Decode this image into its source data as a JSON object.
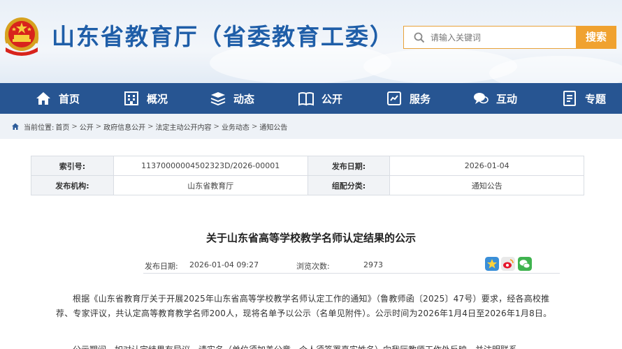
{
  "header": {
    "site_title": "山东省教育厅（省委教育工委）",
    "search_placeholder": "请输入关键词",
    "search_button": "搜索"
  },
  "nav": {
    "items": [
      {
        "label": "首页",
        "icon": "home-icon"
      },
      {
        "label": "概况",
        "icon": "building-icon"
      },
      {
        "label": "动态",
        "icon": "stack-icon"
      },
      {
        "label": "公开",
        "icon": "book-icon"
      },
      {
        "label": "服务",
        "icon": "hands-icon"
      },
      {
        "label": "互动",
        "icon": "chat-icon"
      },
      {
        "label": "专题",
        "icon": "document-icon"
      }
    ]
  },
  "breadcrumb": {
    "prefix": "当前位置:",
    "items": [
      "首页",
      "公开",
      "政府信息公开",
      "法定主动公开内容",
      "业务动态",
      "通知公告"
    ]
  },
  "info_table": {
    "index_label": "索引号:",
    "index_value": "11370000004502323D/2026-00001",
    "date_label": "发布日期:",
    "date_value": "2026-01-04",
    "org_label": "发布机构:",
    "org_value": "山东省教育厅",
    "category_label": "组配分类:",
    "category_value": "通知公告"
  },
  "article": {
    "title": "关于山东省高等学校教学名师认定结果的公示",
    "publish_label": "发布日期:",
    "publish_value": "2026-01-04 09:27",
    "views_label": "浏览次数:",
    "views_value": "2973",
    "paragraph1": "根据《山东省教育厅关于开展2025年山东省高等学校教学名师认定工作的通知》（鲁教师函〔2025〕47号）要求，经各高校推荐、专家评议，共认定高等教育教学名师200人，现将名单予以公示（名单见附件）。公示时间为2026年1月4日至2026年1月8日。",
    "paragraph2": "公示期间，如对认定结果有异议，请实名（单位须加盖公章，个人须签署真实姓名）向我厅教师工作处反映，并注明联系"
  },
  "colors": {
    "brand_blue": "#1f5ea8",
    "nav_blue": "#275592",
    "search_orange": "#f0a230"
  }
}
